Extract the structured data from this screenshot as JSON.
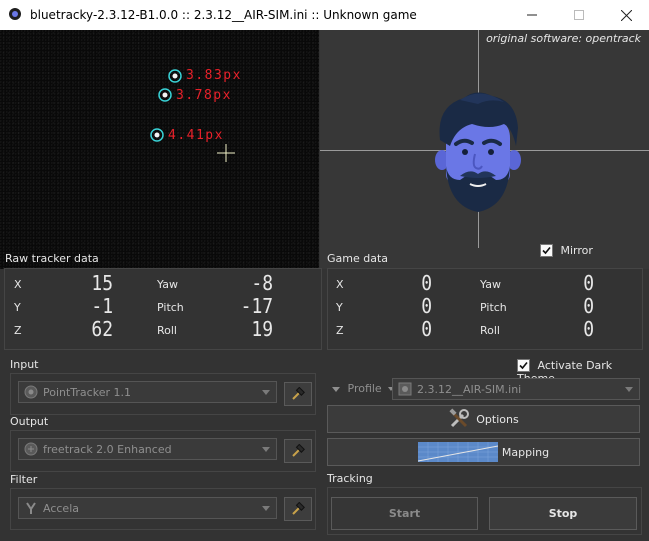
{
  "window": {
    "title": "bluetracky-2.3.12-B1.0.0 :: 2.3.12__AIR-SIM.ini :: Unknown game",
    "minimize_icon": "minimize-icon",
    "maximize_icon": "maximize-icon",
    "close_icon": "close-icon"
  },
  "video": {
    "points": [
      {
        "label": "3.83px"
      },
      {
        "label": "3.78px"
      },
      {
        "label": "4.41px"
      }
    ]
  },
  "head_view": {
    "credit": "original software: opentrack",
    "mirror_label": "Mirror",
    "mirror_checked": true
  },
  "raw_tracker": {
    "title": "Raw tracker data",
    "x_label": "X",
    "x_value": "15",
    "y_label": "Y",
    "y_value": "-1",
    "z_label": "Z",
    "z_value": "62",
    "yaw_label": "Yaw",
    "yaw_value": "-8",
    "pitch_label": "Pitch",
    "pitch_value": "-17",
    "roll_label": "Roll",
    "roll_value": "19"
  },
  "game_data": {
    "title": "Game data",
    "x_label": "X",
    "x_value": "0",
    "y_label": "Y",
    "y_value": "0",
    "z_label": "Z",
    "z_value": "0",
    "yaw_label": "Yaw",
    "yaw_value": "0",
    "pitch_label": "Pitch",
    "pitch_value": "0",
    "roll_label": "Roll",
    "roll_value": "0"
  },
  "modules": {
    "input_title": "Input",
    "input_value": "PointTracker 1.1",
    "output_title": "Output",
    "output_value": "freetrack 2.0 Enhanced",
    "filter_title": "Filter",
    "filter_value": "Accela"
  },
  "profile": {
    "dark_theme_label": "Activate Dark Theme",
    "dark_theme_checked": true,
    "profile_label": "Profile",
    "profile_value": "2.3.12__AIR-SIM.ini",
    "options_label": "Options",
    "mapping_label": "Mapping"
  },
  "tracking": {
    "title": "Tracking",
    "start_label": "Start",
    "stop_label": "Stop"
  },
  "colors": {
    "background": "#333333",
    "accent_red": "#e8212a",
    "marker_cyan": "#39d2d6",
    "face_blue": "#6a77e6"
  }
}
